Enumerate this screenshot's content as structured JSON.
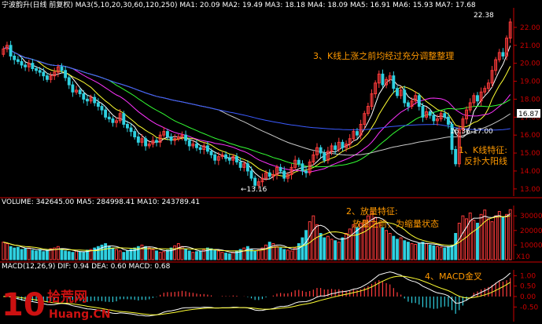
{
  "colors": {
    "background": "#000000",
    "up": "#ff3b3b",
    "down": "#2fd0e0",
    "ma5": "#ffffff",
    "ma10": "#ffff33",
    "ma20": "#ff33ff",
    "ma30": "#33ff33",
    "ma60": "#c8c8c8",
    "ma120": "#3b5bff",
    "ma250": "#808080",
    "annotation": "#ff9900",
    "axis": "#cc0000",
    "diff": "#ffffff",
    "dea": "#ffff33"
  },
  "header": {
    "price": "宁波韵升(日线 前复权) MA3(5,10,20,30,60,120,250) MA1: 20.09 MA2: 19.49 MA3: 18.18 MA4: 18.09 MA5: 16.91 MA6: 15.93 MA7: 17.68",
    "volume": "VOLUME: 342645.00 MA5: 284998.41 MA10: 243789.41",
    "macd": "MACD(12,26,9) DIF: 0.94 DEA: 0.60 MACD: 0.68"
  },
  "annotations": {
    "a3": "3、K线上涨之前均经过充分调整整理",
    "a1_line1": "1、K线特征:",
    "a1_line2": "反扑大阳线",
    "a2_line1": "2、放量特征:",
    "a2_line2": "放量之前，为缩量状态",
    "a4": "4、MACD金叉",
    "low_label": "←13.16",
    "high_label": "22.38",
    "range_label": "16.36-17.00",
    "price_tag": "16.87",
    "watermark_num": "10",
    "watermark_cn": "拾荒网",
    "watermark_url": "Huang.CN",
    "scale_unit": "X10"
  },
  "chart_data": [
    {
      "type": "candlestick",
      "title": "宁波韵升(日线 前复权)",
      "ylim": [
        12.6,
        23.0
      ],
      "y_ticks": [
        13.0,
        14.0,
        15.0,
        16.0,
        17.0,
        18.0,
        19.0,
        20.0,
        21.0,
        22.0
      ],
      "close": [
        20.8,
        21.0,
        20.4,
        20.2,
        20.1,
        19.9,
        19.8,
        20.0,
        19.7,
        19.6,
        19.5,
        19.3,
        19.1,
        19.3,
        19.5,
        19.8,
        19.6,
        19.2,
        18.8,
        18.4,
        18.5,
        18.3,
        18.0,
        17.9,
        18.1,
        17.8,
        17.6,
        17.4,
        17.0,
        16.9,
        16.7,
        16.8,
        17.2,
        16.6,
        16.4,
        16.2,
        15.9,
        15.6,
        15.8,
        15.4,
        15.5,
        15.7,
        15.6,
        16.0,
        16.2,
        15.9,
        15.7,
        15.8,
        15.9,
        16.0,
        15.7,
        15.4,
        15.5,
        15.3,
        15.2,
        15.4,
        15.1,
        14.9,
        14.6,
        14.8,
        14.9,
        14.7,
        14.6,
        14.8,
        14.5,
        14.2,
        14.4,
        14.0,
        13.6,
        13.2,
        13.4,
        13.6,
        13.9,
        13.7,
        13.8,
        14.2,
        14.0,
        13.6,
        13.8,
        14.2,
        14.6,
        14.4,
        14.0,
        13.9,
        14.5,
        14.9,
        15.3,
        15.0,
        14.6,
        15.1,
        15.4,
        15.2,
        15.6,
        15.3,
        15.5,
        15.8,
        16.2,
        16.0,
        16.6,
        17.2,
        17.6,
        18.3,
        18.9,
        19.4,
        18.8,
        19.1,
        19.3,
        18.6,
        18.2,
        18.5,
        17.8,
        17.6,
        17.9,
        18.2,
        17.6,
        17.0,
        17.3,
        17.1,
        16.8,
        16.9,
        17.2,
        17.0,
        16.6,
        15.2,
        14.4,
        16.3,
        16.9,
        17.4,
        17.8,
        18.2,
        17.9,
        18.4,
        18.6,
        18.9,
        19.6,
        20.2,
        20.6,
        20.4,
        21.4,
        22.3
      ],
      "volume": [
        12000,
        11000,
        9000,
        8000,
        8500,
        7000,
        7500,
        8000,
        6500,
        6000,
        7000,
        5500,
        6500,
        7500,
        8000,
        9000,
        7000,
        6000,
        5500,
        5000,
        6000,
        5500,
        5000,
        6500,
        7000,
        8000,
        9000,
        10000,
        11000,
        9000,
        8000,
        7000,
        6000,
        5000,
        6000,
        7000,
        8000,
        9000,
        10000,
        9000,
        8000,
        7000,
        6000,
        5000,
        5500,
        6500,
        8000,
        9500,
        11000,
        9000,
        7000,
        6000,
        5000,
        5500,
        6000,
        7000,
        8000,
        7500,
        6500,
        6000,
        5000,
        4500,
        4000,
        5000,
        6000,
        7000,
        8000,
        9000,
        7000,
        6000,
        6500,
        8000,
        10000,
        12000,
        11000,
        9000,
        8000,
        7000,
        6500,
        6000,
        8000,
        11000,
        15000,
        20000,
        26000,
        30000,
        24000,
        18000,
        15000,
        16000,
        14000,
        13000,
        12000,
        15000,
        18000,
        21000,
        24000,
        22000,
        25000,
        27000,
        30000,
        33000,
        29000,
        25000,
        22000,
        20000,
        18000,
        16000,
        14000,
        15000,
        13000,
        12000,
        11000,
        10500,
        11000,
        12000,
        11000,
        10000,
        9500,
        9000,
        8500,
        8000,
        9000,
        10000,
        18000,
        25000,
        30000,
        28000,
        32000,
        27000,
        25000,
        31000,
        34000,
        28000,
        26000,
        30000,
        33000,
        29000,
        31000,
        34264
      ]
    },
    {
      "type": "bar",
      "title": "VOLUME",
      "y_ticks": [
        10000,
        20000,
        30000
      ],
      "series": [
        {
          "name": "MA5",
          "value": "284998.41"
        },
        {
          "name": "MA10",
          "value": "243789.41"
        }
      ]
    },
    {
      "type": "line",
      "title": "MACD(12,26,9)",
      "y_ticks": [
        -0.5,
        0.0,
        0.5,
        1.0
      ],
      "series": [
        {
          "name": "DIF",
          "value": "0.94"
        },
        {
          "name": "DEA",
          "value": "0.60"
        },
        {
          "name": "MACD",
          "value": "0.68"
        }
      ]
    }
  ]
}
